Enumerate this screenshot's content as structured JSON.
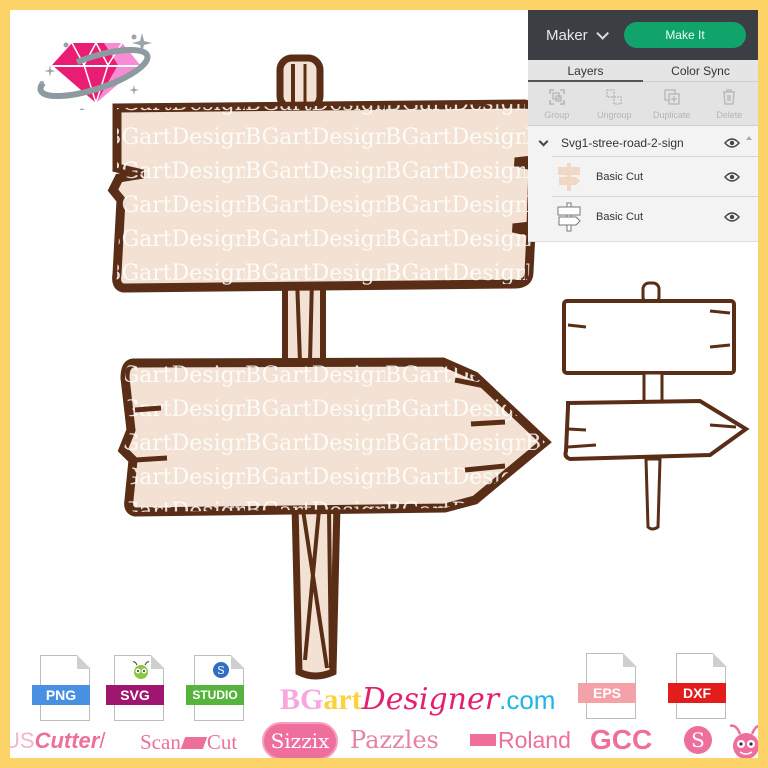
{
  "brand": {
    "part1": "BG",
    "part2": "art",
    "part3": "Designer",
    "part4": ".com",
    "colors": {
      "pink": "#f7a6e0",
      "yellow": "#fcd23a",
      "magenta": "#e3206f",
      "blue": "#1fb6e6"
    }
  },
  "watermark_text": "BGartDesigner",
  "panel": {
    "maker_label": "Maker",
    "make_it_label": "Make It",
    "tabs": [
      {
        "label": "Layers",
        "active": true
      },
      {
        "label": "Color Sync",
        "active": false
      }
    ],
    "tools": [
      {
        "label": "Group",
        "icon": "group-icon"
      },
      {
        "label": "Ungroup",
        "icon": "ungroup-icon"
      },
      {
        "label": "Duplicate",
        "icon": "duplicate-icon"
      },
      {
        "label": "Delete",
        "icon": "trash-icon"
      }
    ],
    "layer_group": {
      "name": "Svg1-stree-road-2-sign",
      "visible": true
    },
    "layers": [
      {
        "name": "Basic Cut",
        "visible": true,
        "thumb": "filled-sign"
      },
      {
        "name": "Basic Cut",
        "visible": true,
        "thumb": "outline-sign"
      }
    ]
  },
  "file_formats": [
    {
      "label": "PNG",
      "color": "#4a90e2"
    },
    {
      "label": "SVG",
      "color": "#a0166f"
    },
    {
      "label": "STUDIO",
      "color": "#56b43c"
    },
    {
      "label": "EPS",
      "color": "#f4a1a8"
    },
    {
      "label": "DXF",
      "color": "#e31c1c"
    }
  ],
  "machine_logos": {
    "uscutter_a": "US",
    "uscutter_b": "Cutter",
    "scancut_a": "Scan",
    "scancut_b": "Cut",
    "sizzix": "Sizzix",
    "pazzles": "Pazzles",
    "roland": "Roland",
    "gcc": "GCC",
    "silhouette": "S"
  },
  "colors": {
    "frame": "#fdd267",
    "wood_fill": "#f3e2d3",
    "wood_stroke": "#5a2d17",
    "panel_dark": "#3b3f44",
    "make_it_green": "#10a36b"
  }
}
